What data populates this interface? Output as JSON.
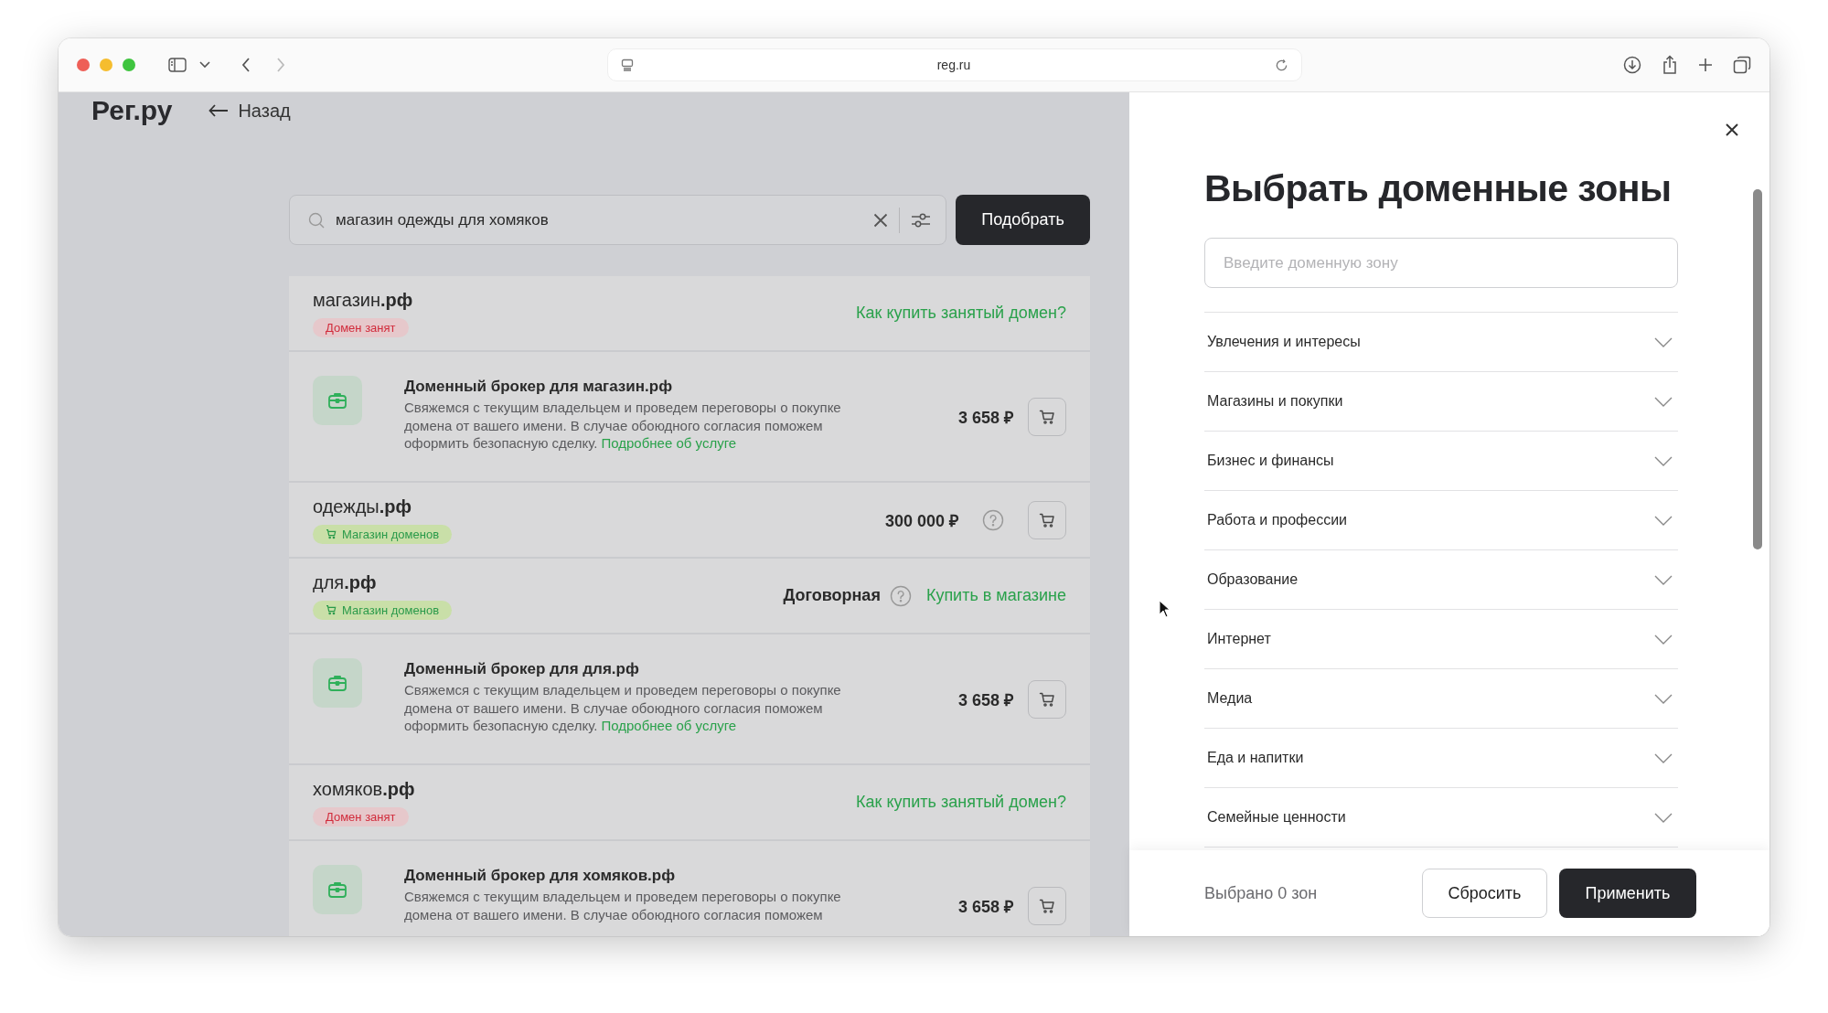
{
  "browser": {
    "url": "reg.ru"
  },
  "page": {
    "logo": "Рег.ру",
    "back": "Назад",
    "search": {
      "value": "магазин одежды для хомяков"
    },
    "search_button": "Подобрать",
    "results": [
      {
        "kind": "domain",
        "name": "магазин**.рф**",
        "badge": {
          "kind": "taken",
          "text": "Домен занят"
        },
        "link": "Как купить занятый домен?"
      },
      {
        "kind": "broker",
        "title": "Доменный брокер для магазин.рф",
        "description": "Свяжемся с текущим владельцем и проведем переговоры о покупке домена от вашего имени. В случае обоюдного согласия поможем оформить безопасную сделку.",
        "link": "Подробнее об услуге",
        "price": "3 658 ₽"
      },
      {
        "kind": "domain",
        "name": "одежды**.рф**",
        "badge": {
          "kind": "shop",
          "text": "Магазин доменов"
        },
        "price": "300 000 ₽"
      },
      {
        "kind": "domain",
        "name": "для**.рф**",
        "badge": {
          "kind": "shop",
          "text": "Магазин доменов"
        },
        "price": "Договорная",
        "link": "Купить в магазине"
      },
      {
        "kind": "broker",
        "title": "Доменный брокер для для.рф",
        "description": "Свяжемся с текущим владельцем и проведем переговоры о покупке домена от вашего имени. В случае обоюдного согласия поможем оформить безопасную сделку.",
        "link": "Подробнее об услуге",
        "price": "3 658 ₽"
      },
      {
        "kind": "domain",
        "name": "хомяков**.рф**",
        "badge": {
          "kind": "taken",
          "text": "Домен занят"
        },
        "link": "Как купить занятый домен?"
      },
      {
        "kind": "broker",
        "title": "Доменный брокер для хомяков.рф",
        "description": "Свяжемся с текущим владельцем и проведем переговоры о покупке домена от вашего имени. В случае обоюдного согласия поможем",
        "price": "3 658 ₽"
      }
    ]
  },
  "panel": {
    "title": "Выбрать доменные зоны",
    "search": {
      "placeholder": "Введите доменную зону"
    },
    "categories": [
      {
        "label": "Увлечения и интересы",
        "expanded": false
      },
      {
        "label": "Магазины и покупки",
        "expanded": false
      },
      {
        "label": "Бизнес и финансы",
        "expanded": false
      },
      {
        "label": "Работа и профессии",
        "expanded": false
      },
      {
        "label": "Образование",
        "expanded": false
      },
      {
        "label": "Интернет",
        "expanded": false
      },
      {
        "label": "Медиа",
        "expanded": false
      },
      {
        "label": "Еда и напитки",
        "expanded": false
      },
      {
        "label": "Семейные ценности",
        "expanded": false
      }
    ],
    "selected_count": "Выбрано 0 зон",
    "reset_button": "Сбросить",
    "apply_button": "Применить"
  }
}
